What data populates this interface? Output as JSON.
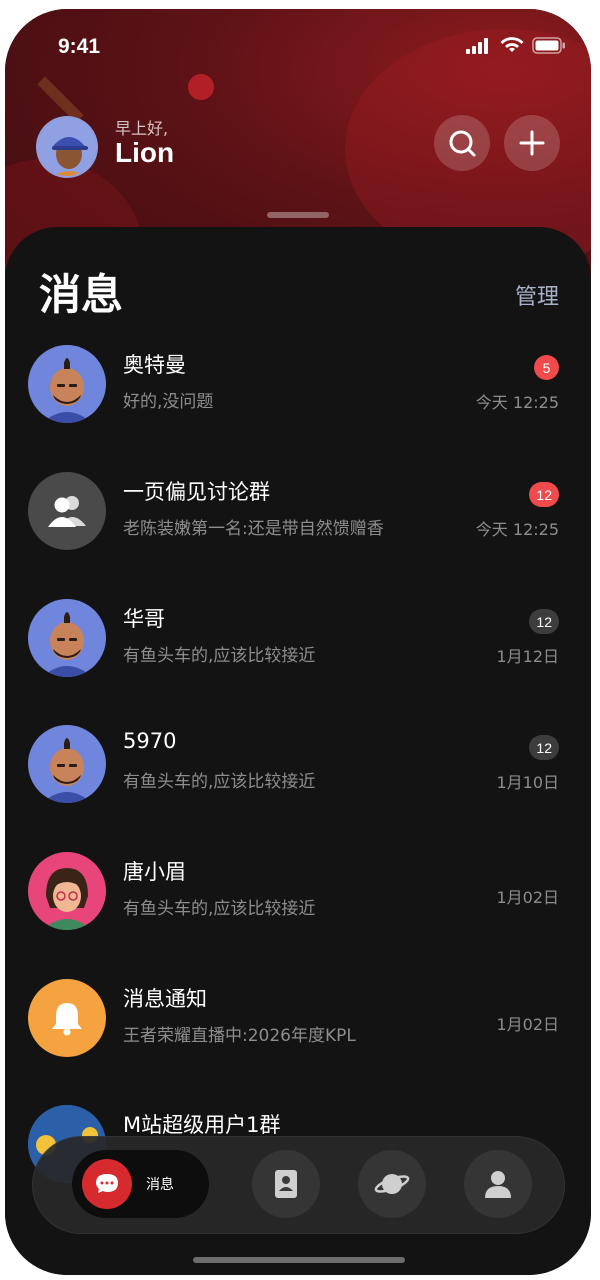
{
  "status_bar": {
    "time": "9:41"
  },
  "greeting": {
    "subtitle": "早上好,",
    "name": "Lion"
  },
  "header": {
    "title": "消息",
    "manage_label": "管理"
  },
  "conversations": [
    {
      "name": "奥特曼",
      "preview": "好的,没问题",
      "time": "今天 12:25",
      "badge": "5",
      "badge_color": "red",
      "avatar": "bald-man"
    },
    {
      "name": "一页偏见讨论群",
      "preview": "老陈装嫩第一名:还是带自然馈赠香",
      "time": "今天 12:25",
      "badge": "12",
      "badge_color": "red",
      "avatar": "group-icon"
    },
    {
      "name": "华哥",
      "preview": "有鱼头车的,应该比较接近",
      "time": "1月12日",
      "badge": "12",
      "badge_color": "gray",
      "avatar": "bald-man"
    },
    {
      "name": "5970",
      "preview": "有鱼头车的,应该比较接近",
      "time": "1月10日",
      "badge": "12",
      "badge_color": "gray",
      "avatar": "bald-man"
    },
    {
      "name": "唐小眉",
      "preview": "有鱼头车的,应该比较接近",
      "time": "1月02日",
      "badge": "",
      "avatar": "woman"
    },
    {
      "name": "消息通知",
      "preview": "王者荣耀直播中:2026年度KPL",
      "time": "1月02日",
      "badge": "",
      "avatar": "bell-icon"
    },
    {
      "name": "M站超级用户1群",
      "preview": "",
      "time": "",
      "badge": "",
      "avatar": "group-photo"
    }
  ],
  "tabbar": {
    "active_label": "消息",
    "tabs": [
      "chat-icon",
      "contacts-icon",
      "planet-icon",
      "profile-icon"
    ]
  },
  "colors": {
    "accent": "#d62a2f",
    "badge_red": "#ef4a4c",
    "badge_gray": "#3d3d3d",
    "background": "#131313"
  }
}
